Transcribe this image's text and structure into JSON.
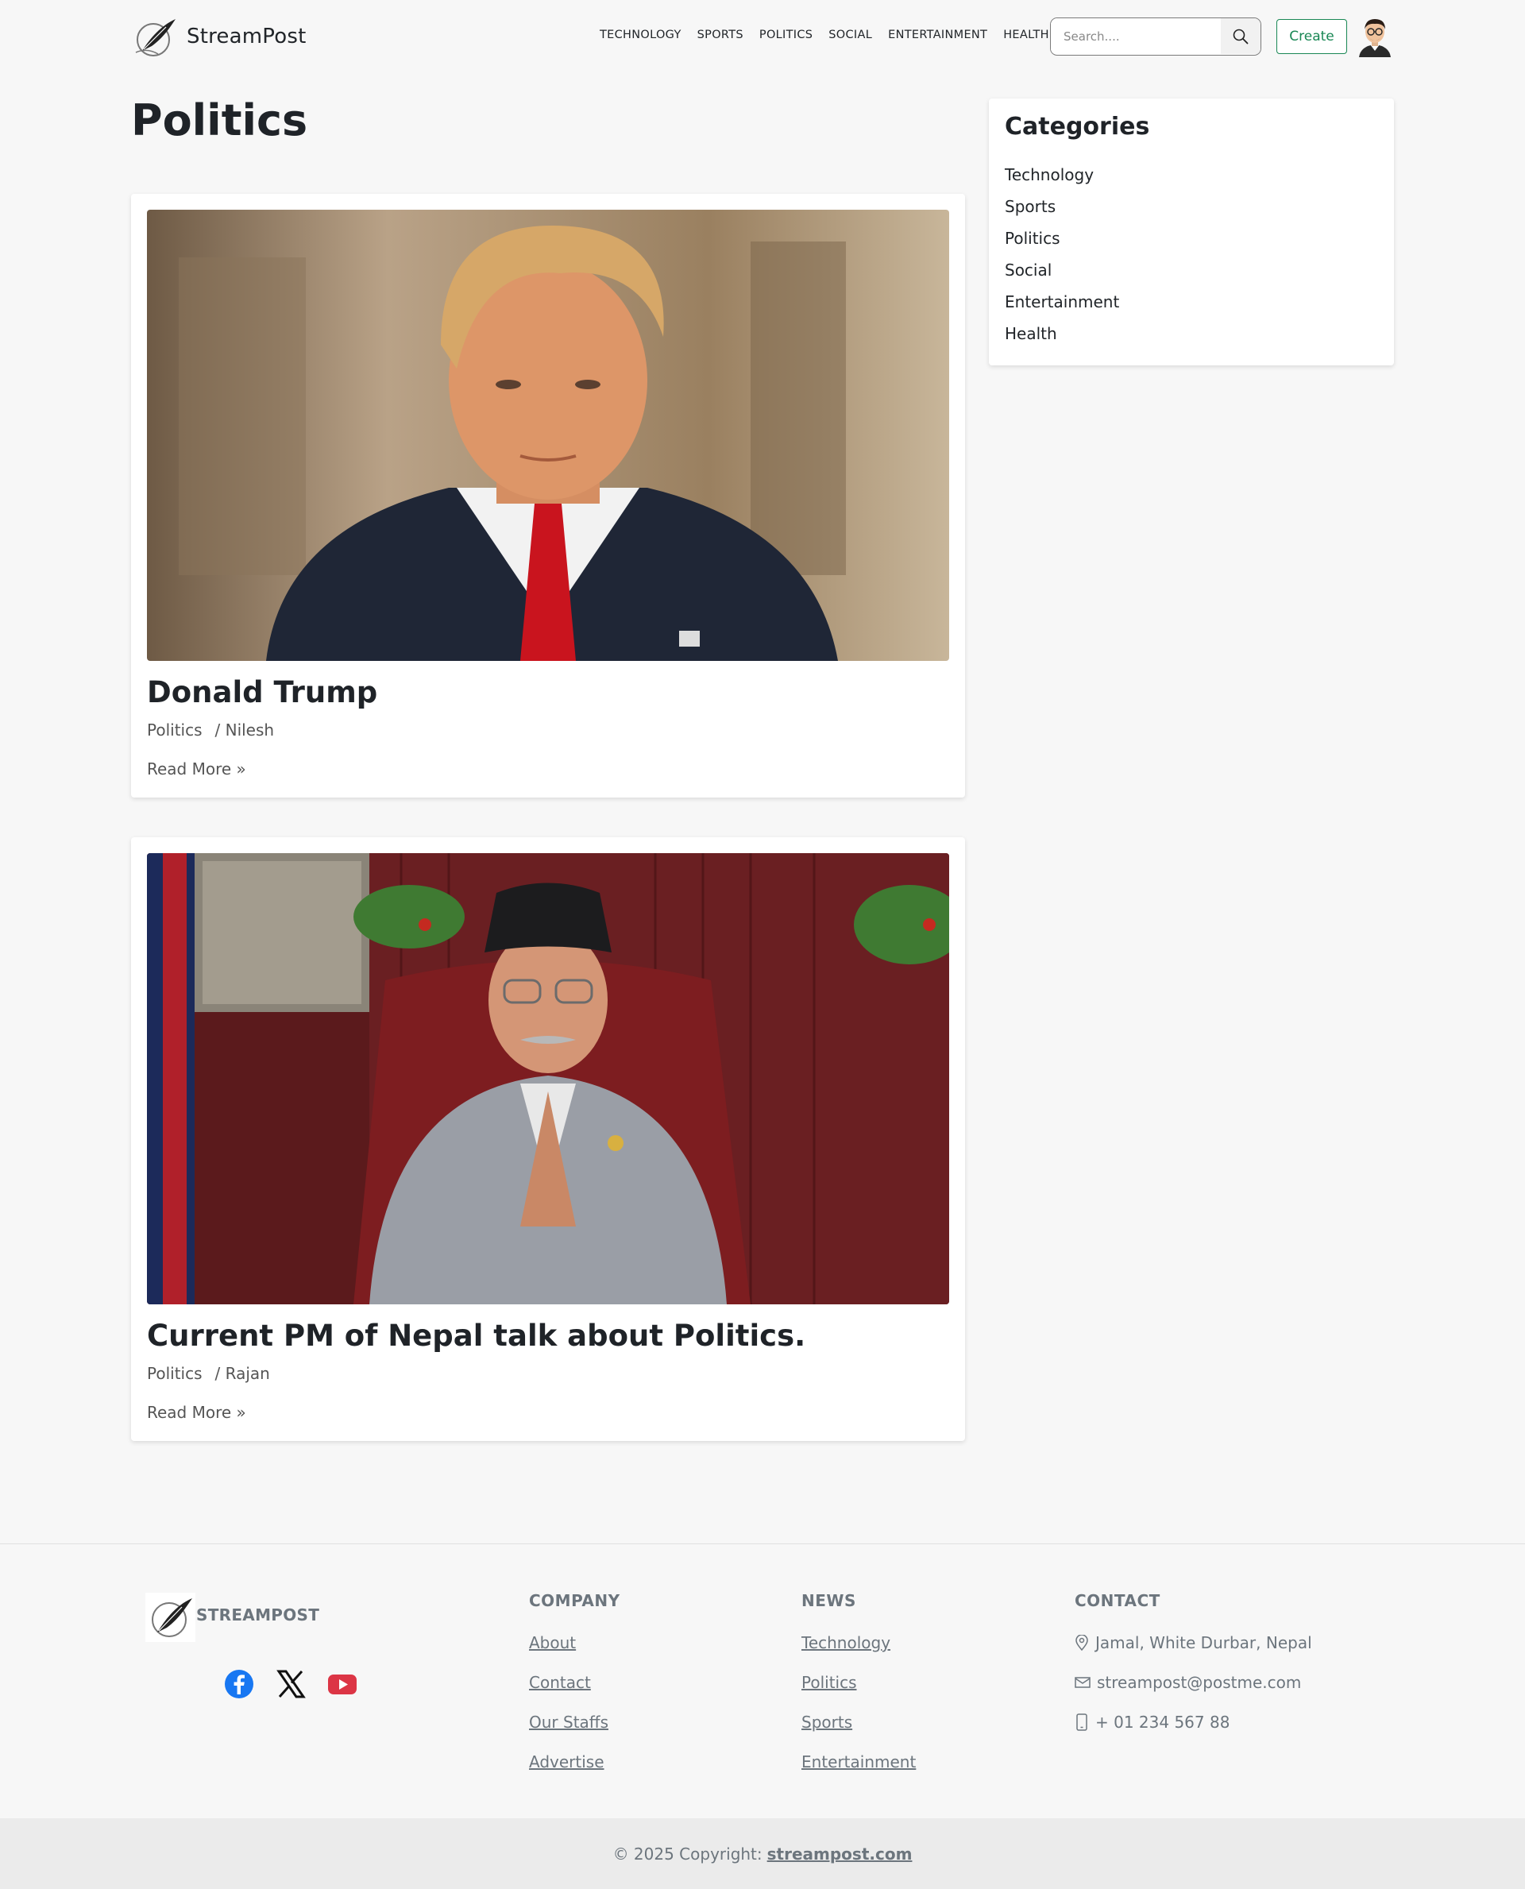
{
  "brand": {
    "name": "StreamPost"
  },
  "nav": {
    "links": [
      "TECHNOLOGY",
      "SPORTS",
      "POLITICS",
      "SOCIAL",
      "ENTERTAINMENT",
      "HEALTH"
    ]
  },
  "search": {
    "placeholder": "Search...."
  },
  "header": {
    "create_label": "Create"
  },
  "page": {
    "title": "Politics"
  },
  "posts": [
    {
      "title": "Donald Trump",
      "category": "Politics",
      "author": "/ Nilesh",
      "read_more": "Read More »"
    },
    {
      "title": "Current PM of Nepal talk about Politics.",
      "category": "Politics",
      "author": "/ Rajan",
      "read_more": "Read More »"
    }
  ],
  "sidebar": {
    "heading": "Categories",
    "items": [
      "Technology",
      "Sports",
      "Politics",
      "Social",
      "Entertainment",
      "Health"
    ]
  },
  "footer": {
    "brand": "STREAMPOST",
    "social_icons": [
      "facebook-icon",
      "x-icon",
      "youtube-icon"
    ],
    "company": {
      "heading": "COMPANY",
      "links": [
        "About",
        "Contact",
        "Our Staffs",
        "Advertise"
      ]
    },
    "news": {
      "heading": "NEWS",
      "links": [
        "Technology",
        "Politics",
        "Sports",
        "Entertainment"
      ]
    },
    "contact": {
      "heading": "CONTACT",
      "address": "Jamal, White Durbar, Nepal",
      "email": "streampost@postme.com",
      "phone": "+ 01 234 567 88"
    },
    "copyright_prefix": "© 2025 Copyright:",
    "copyright_link": "streampost.com"
  },
  "colors": {
    "accent_green": "#198754",
    "page_bg": "#f7f7f7",
    "muted_text": "#6c757d",
    "facebook_blue": "#1877f2",
    "youtube_red": "#dc3545"
  }
}
